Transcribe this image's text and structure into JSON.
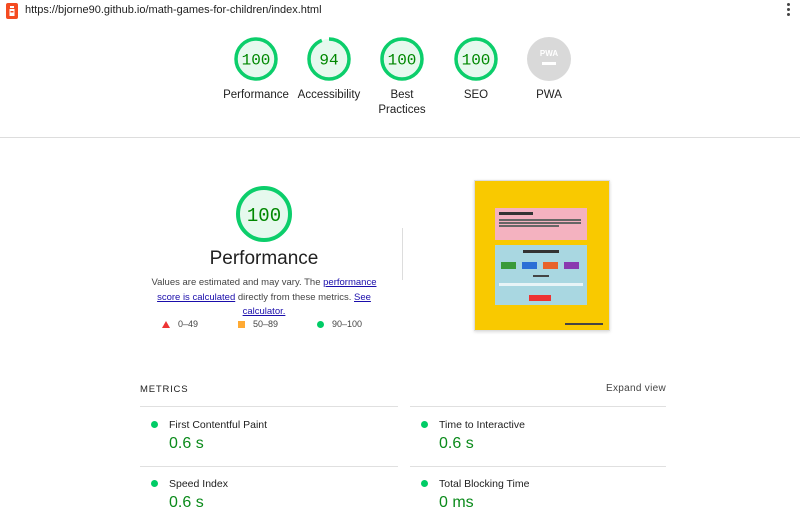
{
  "browser": {
    "url": "https://bjorne90.github.io/math-games-for-children/index.html"
  },
  "summary": {
    "gauges": [
      {
        "score": "100",
        "label": "Performance",
        "value": 1.0,
        "color": "#0cce6b"
      },
      {
        "score": "94",
        "label": "Accessibility",
        "value": 0.94,
        "color": "#0cce6b"
      },
      {
        "score": "100",
        "label": "Best Practices",
        "value": 1.0,
        "color": "#0cce6b"
      },
      {
        "score": "100",
        "label": "SEO",
        "value": 1.0,
        "color": "#0cce6b"
      },
      {
        "score": "PWA",
        "label": "PWA",
        "value": 0,
        "color": "#cccccc"
      }
    ]
  },
  "performance": {
    "score": "100",
    "title": "Performance",
    "desc_prefix": "Values are estimated and may vary. The ",
    "desc_link1": "performance score is calculated",
    "desc_middle": " directly from these metrics. ",
    "desc_link2": "See calculator.",
    "legend": [
      {
        "range": "0–49",
        "shape": "triangle",
        "color": "#ff3333"
      },
      {
        "range": "50–89",
        "shape": "square",
        "color": "#ffaa33"
      },
      {
        "range": "90–100",
        "shape": "circle",
        "color": "#0cce6b"
      }
    ]
  },
  "metrics": {
    "heading": "METRICS",
    "expand_label": "Expand view",
    "items": [
      {
        "name": "First Contentful Paint",
        "value": "0.6 s"
      },
      {
        "name": "Time to Interactive",
        "value": "0.6 s"
      },
      {
        "name": "Speed Index",
        "value": "0.6 s"
      },
      {
        "name": "Total Blocking Time",
        "value": "0 ms"
      }
    ]
  },
  "colors": {
    "pass": "#0cce6b",
    "pass_text": "#008800",
    "accent_link": "#1a0dab"
  }
}
